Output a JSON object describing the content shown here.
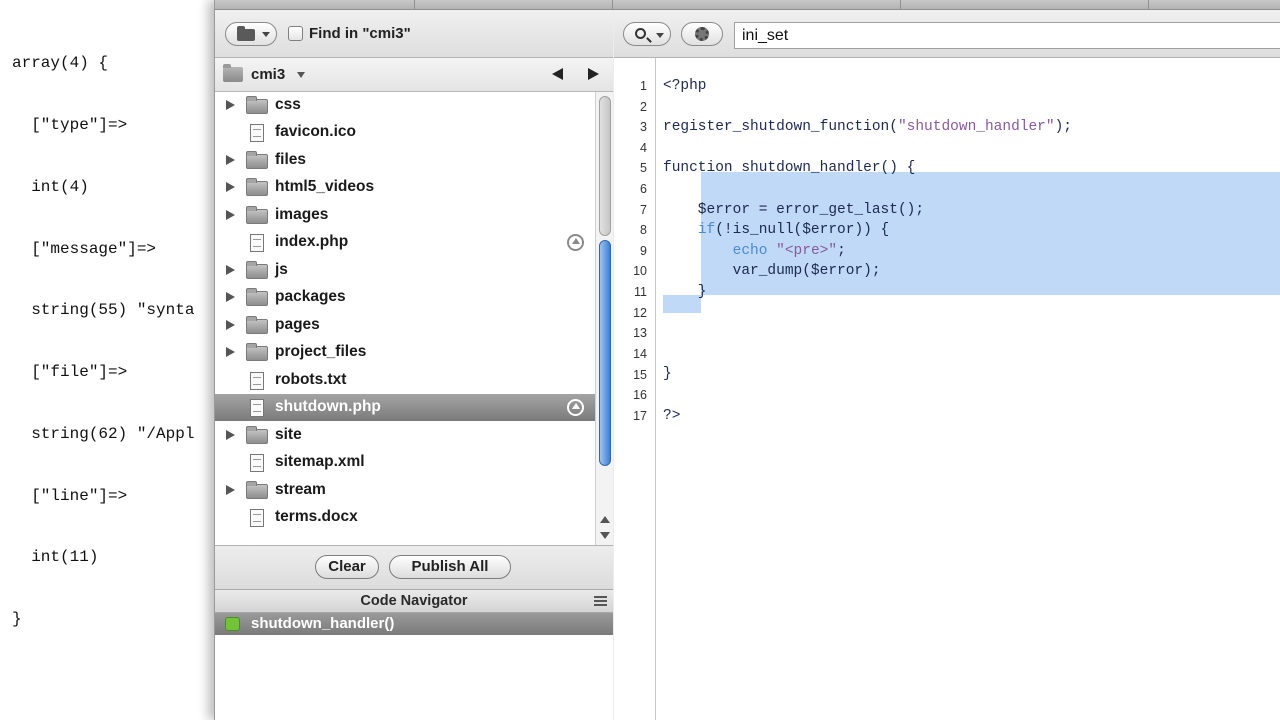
{
  "background_output": {
    "lines": [
      "array(4) {",
      "  [\"type\"]=>",
      "  int(4)",
      "  [\"message\"]=>",
      "  string(55) \"synta",
      "  [\"file\"]=>",
      "  string(62) \"/Appl",
      "  [\"line\"]=>",
      "  int(11)",
      "}"
    ]
  },
  "files_toolbar": {
    "find_label": "Find in \"cmi3\""
  },
  "folder_bar": {
    "current_folder": "cmi3"
  },
  "files": [
    {
      "name": "css",
      "type": "folder"
    },
    {
      "name": "favicon.ico",
      "type": "file"
    },
    {
      "name": "files",
      "type": "folder"
    },
    {
      "name": "html5_videos",
      "type": "folder"
    },
    {
      "name": "images",
      "type": "folder"
    },
    {
      "name": "index.php",
      "type": "file",
      "upload": true
    },
    {
      "name": "js",
      "type": "folder"
    },
    {
      "name": "packages",
      "type": "folder"
    },
    {
      "name": "pages",
      "type": "folder"
    },
    {
      "name": "project_files",
      "type": "folder"
    },
    {
      "name": "robots.txt",
      "type": "file"
    },
    {
      "name": "shutdown.php",
      "type": "file",
      "upload": true,
      "selected": true
    },
    {
      "name": "site",
      "type": "folder"
    },
    {
      "name": "sitemap.xml",
      "type": "file"
    },
    {
      "name": "stream",
      "type": "folder"
    },
    {
      "name": "terms.docx",
      "type": "file"
    }
  ],
  "buttons": {
    "clear": "Clear",
    "publish_all": "Publish All"
  },
  "code_navigator": {
    "title": "Code Navigator",
    "items": [
      "shutdown_handler()"
    ]
  },
  "editor": {
    "search_value": "ini_set",
    "line_numbers": [
      "1",
      "2",
      "3",
      "4",
      "5",
      "6",
      "7",
      "8",
      "9",
      "10",
      "11",
      "12",
      "13",
      "14",
      "15",
      "16",
      "17"
    ],
    "code_lines": [
      "<?php",
      "",
      "register_shutdown_function(\"shutdown_handler\");",
      "",
      "function shutdown_handler() {",
      "",
      "    $error = error_get_last();",
      "    if(!is_null($error)) {",
      "        echo \"<pre>\";",
      "        var_dump($error);",
      "    }",
      "",
      "",
      "",
      "}",
      "",
      "?>"
    ],
    "selection_lines": [
      6,
      7,
      8,
      9,
      10,
      11,
      12
    ]
  },
  "colors": {
    "selection": "#bfd9f6",
    "string": "#8a5a9c",
    "keyword": "#4d8ad6",
    "selected_row": "#8a8a8a",
    "scroll_thumb": "#3d7ed6"
  }
}
